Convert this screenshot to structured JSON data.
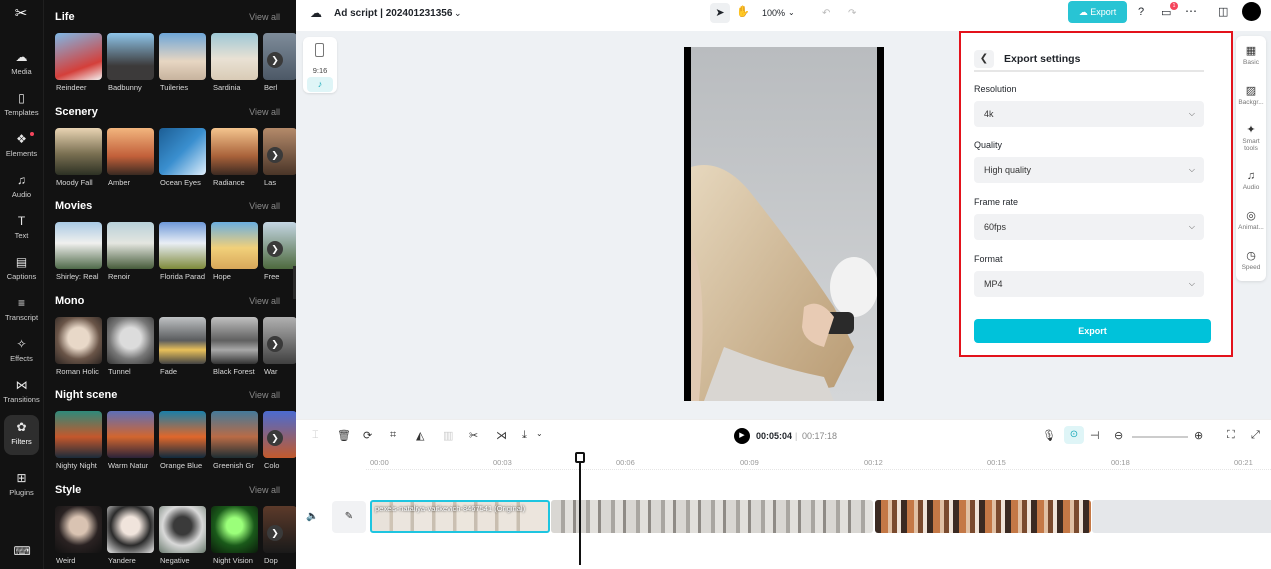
{
  "nav": {
    "items": [
      {
        "label": "Media",
        "icon": "media-icon"
      },
      {
        "label": "Templates",
        "icon": "templates-icon"
      },
      {
        "label": "Elements",
        "icon": "elements-icon"
      },
      {
        "label": "Audio",
        "icon": "audio-icon"
      },
      {
        "label": "Text",
        "icon": "text-icon"
      },
      {
        "label": "Captions",
        "icon": "captions-icon"
      },
      {
        "label": "Transcript",
        "icon": "transcript-icon"
      },
      {
        "label": "Effects",
        "icon": "effects-icon"
      },
      {
        "label": "Transitions",
        "icon": "transitions-icon"
      },
      {
        "label": "Filters",
        "icon": "filters-icon"
      },
      {
        "label": "Plugins",
        "icon": "plugins-icon"
      }
    ]
  },
  "panel": {
    "view_all": "View all",
    "sections": [
      {
        "title": "Life",
        "items": [
          "Reindeer",
          "Badbunny",
          "Tuileries",
          "Sardinia",
          "Berl"
        ]
      },
      {
        "title": "Scenery",
        "items": [
          "Moody Fall",
          "Amber",
          "Ocean Eyes",
          "Radiance",
          "Las"
        ]
      },
      {
        "title": "Movies",
        "items": [
          "Shirley: Real",
          "Renoir",
          "Florida Parad",
          "Hope",
          "Free"
        ]
      },
      {
        "title": "Mono",
        "items": [
          "Roman Holic",
          "Tunnel",
          "Fade",
          "Black Forest",
          "War"
        ]
      },
      {
        "title": "Night scene",
        "items": [
          "Nighty Night",
          "Warm Natur",
          "Orange Blue",
          "Greenish Gr",
          "Colo"
        ]
      },
      {
        "title": "Style",
        "items": [
          "Weird",
          "Yandere",
          "Negative",
          "Night Vision",
          "Dop"
        ]
      }
    ]
  },
  "topbar": {
    "project_title": "Ad script | 202401231356",
    "zoom": "100%",
    "export_label": "Export",
    "notification_count": "1"
  },
  "stage": {
    "ratio_label": "9:16"
  },
  "export_settings": {
    "title": "Export settings",
    "resolution_label": "Resolution",
    "resolution_value": "4k",
    "quality_label": "Quality",
    "quality_value": "High quality",
    "framerate_label": "Frame rate",
    "framerate_value": "60fps",
    "format_label": "Format",
    "format_value": "MP4",
    "export_button": "Export"
  },
  "rail": {
    "items": [
      "Basic",
      "Backgr...",
      "Smart tools",
      "Audio",
      "Animat...",
      "Speed"
    ]
  },
  "timeline": {
    "current_time": "00:05:04",
    "total_time": "00:17:18",
    "ticks": [
      "00:00",
      "00:03",
      "00:06",
      "00:09",
      "00:12",
      "00:15",
      "00:18",
      "00:21"
    ],
    "clip_name": "pexels-nataliya-vaitkevich-8467541 (Original)"
  }
}
